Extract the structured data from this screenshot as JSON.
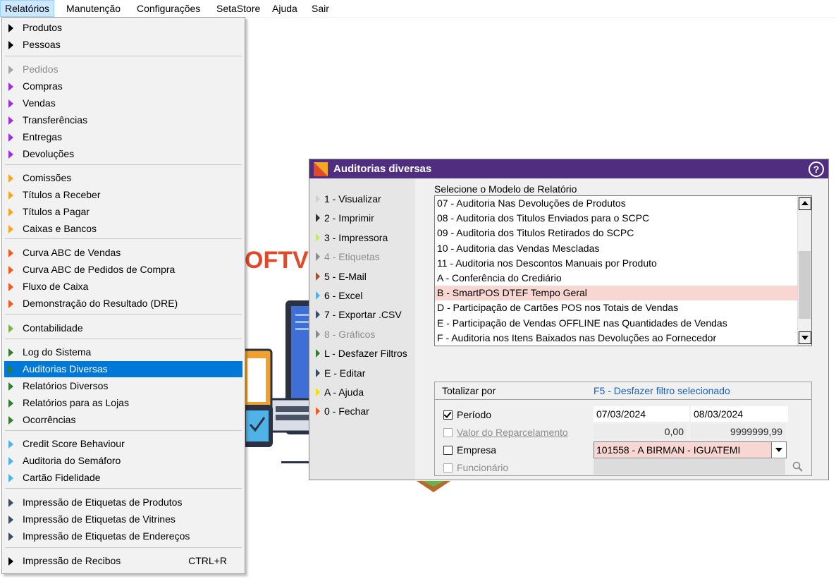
{
  "menubar": {
    "items": [
      "Relatórios",
      "Manutenção",
      "Configurações",
      "SetaStore",
      "Ajuda",
      "Sair"
    ]
  },
  "menu": {
    "groups": [
      [
        {
          "label": "Produtos",
          "color": "#000000",
          "state": "normal"
        },
        {
          "label": "Pessoas",
          "color": "#000000",
          "state": "normal"
        }
      ],
      [
        {
          "label": "Pedidos",
          "color": "#a6a6a6",
          "state": "disabled"
        },
        {
          "label": "Compras",
          "color": "#9b30d9",
          "state": "normal"
        },
        {
          "label": "Vendas",
          "color": "#9b30d9",
          "state": "normal"
        },
        {
          "label": "Transferências",
          "color": "#9b30d9",
          "state": "normal"
        },
        {
          "label": "Entregas",
          "color": "#9b30d9",
          "state": "normal"
        },
        {
          "label": "Devoluções",
          "color": "#9b30d9",
          "state": "normal"
        }
      ],
      [
        {
          "label": "Comissões",
          "color": "#f5a623",
          "state": "normal"
        },
        {
          "label": "Títulos a Receber",
          "color": "#f5a623",
          "state": "normal"
        },
        {
          "label": "Títulos a Pagar",
          "color": "#f5a623",
          "state": "normal"
        },
        {
          "label": "Caixas e Bancos",
          "color": "#f5a623",
          "state": "normal"
        }
      ],
      [
        {
          "label": "Curva ABC de Vendas",
          "color": "#f05a22",
          "state": "normal"
        },
        {
          "label": "Curva ABC de Pedidos de Compra",
          "color": "#f05a22",
          "state": "normal"
        },
        {
          "label": "Fluxo de Caixa",
          "color": "#f05a22",
          "state": "normal"
        },
        {
          "label": "Demonstração do Resultado (DRE)",
          "color": "#f05a22",
          "state": "normal"
        }
      ],
      [
        {
          "label": "Contabilidade",
          "color": "#7cb342",
          "state": "normal"
        }
      ],
      [
        {
          "label": "Log do Sistema",
          "color": "#2e7d32",
          "state": "normal"
        },
        {
          "label": "Auditorias Diversas",
          "color": "#2e7d32",
          "state": "selected"
        },
        {
          "label": "Relatórios Diversos",
          "color": "#2e7d32",
          "state": "normal"
        },
        {
          "label": "Relatórios para as Lojas",
          "color": "#2e7d32",
          "state": "normal"
        },
        {
          "label": "Ocorrências",
          "color": "#2e7d32",
          "state": "normal"
        }
      ],
      [
        {
          "label": "Credit Score Behaviour",
          "color": "#4fb3e8",
          "state": "normal"
        },
        {
          "label": "Auditoria do Semáforo",
          "color": "#4fb3e8",
          "state": "normal"
        },
        {
          "label": "Cartão Fidelidade",
          "color": "#4fb3e8",
          "state": "normal"
        }
      ],
      [
        {
          "label": "Impressão de Etiquetas de Produtos",
          "color": "#3d4a66",
          "state": "normal"
        },
        {
          "label": "Impressão de Etiquetas de Vitrines",
          "color": "#3d4a66",
          "state": "normal"
        },
        {
          "label": "Impressão de Etiquetas de Endereços",
          "color": "#3d4a66",
          "state": "normal"
        }
      ],
      [
        {
          "label": "Impressão de Recibos",
          "shortcut": "CTRL+R",
          "color": "#000000",
          "state": "normal"
        }
      ]
    ]
  },
  "background": {
    "brand_text": "OFTV"
  },
  "dialog": {
    "title": "Auditorias diversas",
    "help_glyph": "?",
    "actions": [
      {
        "label": "1 - Visualizar",
        "color": "#d0d0d0",
        "state": "normal"
      },
      {
        "label": "2 - Imprimir",
        "color": "#333333",
        "state": "normal"
      },
      {
        "label": "3 - Impressora",
        "color": "#c8e66a",
        "state": "normal"
      },
      {
        "label": "4 - Etiquetas",
        "color": "#8a8a8a",
        "state": "disabled"
      },
      {
        "label": "5 - E-Mail",
        "color": "#a0522d",
        "state": "normal"
      },
      {
        "label": "6 - Excel",
        "color": "#4fb3e8",
        "state": "normal"
      },
      {
        "label": "7 - Exportar .CSV",
        "color": "#3d4a66",
        "state": "normal"
      },
      {
        "label": "8 - Gráficos",
        "color": "#8a8a8a",
        "state": "disabled"
      },
      {
        "label": "L - Desfazer Filtros",
        "color": "#2e7d32",
        "state": "normal"
      },
      {
        "label": "E - Editar",
        "color": "#3d4a66",
        "state": "normal"
      },
      {
        "label": "A - Ajuda",
        "color": "#f0e000",
        "state": "normal"
      },
      {
        "label": "0 - Fechar",
        "color": "#f05a22",
        "state": "normal"
      }
    ],
    "select_label": "Selecione o Modelo de Relatório",
    "list_items": [
      "07 - Auditoria Nas Devoluções de Produtos",
      "08 - Auditoria dos Titulos Enviados para o SCPC",
      "09 - Auditoria dos Titulos Retirados do SCPC",
      "10 - Auditoria das Vendas Mescladas",
      "11 - Auditoria nos Descontos Manuais por Produto",
      "A - Conferência do Crediário",
      "B - SmartPOS DTEF Tempo Geral",
      "D - Participação de Cartões POS nos Totais de Vendas",
      "E - Participação de Vendas OFFLINE nas Quantidades de Vendas",
      "F - Auditoria nos Itens Baixados nas Devoluções ao Fornecedor"
    ],
    "selected_list_item": "B - SmartPOS DTEF Tempo Geral",
    "totalizar": {
      "title": "Totalizar por",
      "f5_link": "F5 - Desfazer filtro selecionado",
      "periodo": {
        "label": "Período",
        "checked": true,
        "from": "07/03/2024",
        "to": "08/03/2024"
      },
      "valor": {
        "label": "Valor do Reparcelamento",
        "checked": false,
        "from": "0,00",
        "to": "9999999,99"
      },
      "empresa": {
        "label": "Empresa",
        "checked": false,
        "value": "101558 - A BIRMAN - IGUATEMI"
      },
      "funcionario": {
        "label": "Funcionário",
        "checked": false,
        "value": ""
      }
    }
  }
}
